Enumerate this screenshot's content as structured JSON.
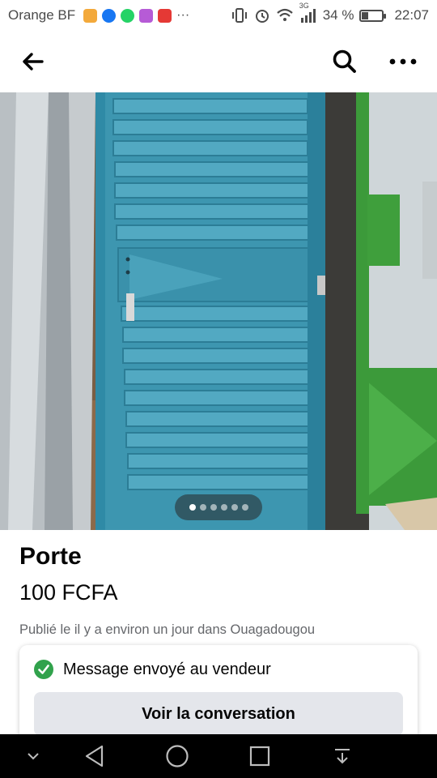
{
  "status_bar": {
    "carrier": "Orange BF",
    "network": "3G",
    "battery_percent": "34 %",
    "battery_level": 0.34,
    "time": "22:07",
    "app_icons": [
      "shop-icon",
      "facebook-icon",
      "whatsapp-icon",
      "gallery-icon",
      "huawei-icon"
    ],
    "app_colors": [
      "#f3a93b",
      "#1877f2",
      "#25d366",
      "#b65bd6",
      "#e53935"
    ],
    "overflow": "···"
  },
  "header": {
    "back_icon": "arrow-left-icon",
    "search_icon": "search-icon",
    "more_icon": "more-horizontal-icon"
  },
  "hero": {
    "image_description_icon": "photo",
    "dot_count": 6,
    "active_dot": 0
  },
  "listing": {
    "title": "Porte",
    "price": "100 FCFA",
    "posted": "Publié le il y a environ un jour dans Ouagadougou"
  },
  "message_card": {
    "status_text": "Message envoyé au vendeur",
    "button_label": "Voir la conversation",
    "check_color": "#31a24c"
  },
  "nav_bar": {
    "items": [
      "chevron-down-icon",
      "back-triangle-icon",
      "home-circle-icon",
      "recents-square-icon",
      "notification-pulldown-icon"
    ]
  },
  "colors": {
    "door": "#3d96b0",
    "green_door": "#3c9a3a",
    "button_bg": "#e4e6eb",
    "meta_text": "#65676b"
  }
}
